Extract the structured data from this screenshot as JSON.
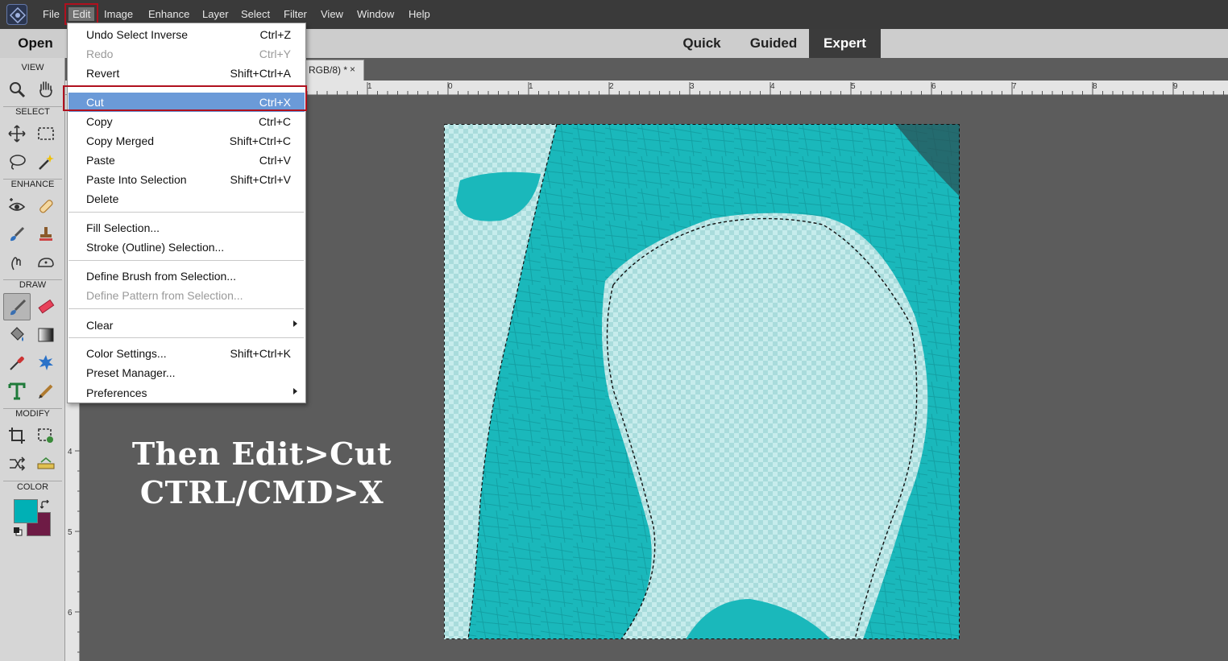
{
  "menubar": {
    "items": [
      "File",
      "Edit",
      "Image",
      "Enhance",
      "Layer",
      "Select",
      "Filter",
      "View",
      "Window",
      "Help"
    ],
    "active_item": "Edit"
  },
  "modebar": {
    "open_label": "Open",
    "modes": [
      "Quick",
      "Guided",
      "Expert"
    ],
    "active_mode": "Expert"
  },
  "toolbox": {
    "sections": {
      "view": "VIEW",
      "select": "SELECT",
      "enhance": "ENHANCE",
      "draw": "DRAW",
      "modify": "MODIFY",
      "color": "COLOR"
    },
    "foreground_color": "#00b0b5",
    "background_color": "#6e1b45"
  },
  "document": {
    "tab_title": "RGB/8) *",
    "tab_close": "×"
  },
  "rulers": {
    "horizontal_ticks": [
      "1",
      "0",
      "1",
      "2",
      "3",
      "4",
      "5",
      "6",
      "7",
      "8",
      "9"
    ],
    "vertical_ticks": [
      "4",
      "5",
      "6"
    ]
  },
  "edit_menu": {
    "items": [
      {
        "label": "Undo Select Inverse",
        "shortcut": "Ctrl+Z"
      },
      {
        "label": "Redo",
        "shortcut": "Ctrl+Y"
      },
      {
        "label": "Revert",
        "shortcut": "Shift+Ctrl+A"
      },
      {
        "label": "Cut",
        "shortcut": "Ctrl+X"
      },
      {
        "label": "Copy",
        "shortcut": "Ctrl+C"
      },
      {
        "label": "Copy Merged",
        "shortcut": "Shift+Ctrl+C"
      },
      {
        "label": "Paste",
        "shortcut": "Ctrl+V"
      },
      {
        "label": "Paste Into Selection",
        "shortcut": "Shift+Ctrl+V"
      },
      {
        "label": "Delete",
        "shortcut": ""
      },
      {
        "label": "Fill Selection...",
        "shortcut": ""
      },
      {
        "label": "Stroke (Outline) Selection...",
        "shortcut": ""
      },
      {
        "label": "Define Brush from Selection...",
        "shortcut": ""
      },
      {
        "label": "Define Pattern from Selection...",
        "shortcut": ""
      },
      {
        "label": "Clear",
        "shortcut": ""
      },
      {
        "label": "Color Settings...",
        "shortcut": "Shift+Ctrl+K"
      },
      {
        "label": "Preset Manager...",
        "shortcut": ""
      },
      {
        "label": "Preferences",
        "shortcut": ""
      }
    ],
    "highlighted_item": "Cut",
    "disabled_items": [
      "Redo",
      "Define Pattern from Selection..."
    ],
    "submenu_items": [
      "Clear",
      "Preferences"
    ]
  },
  "overlay_caption": {
    "line1": "Then Edit>Cut",
    "line2": "CTRL/CMD>X"
  },
  "colors": {
    "accent_red": "#b0101e",
    "menu_highlight": "#6b9ad8",
    "teal": "#1ab8bb"
  }
}
